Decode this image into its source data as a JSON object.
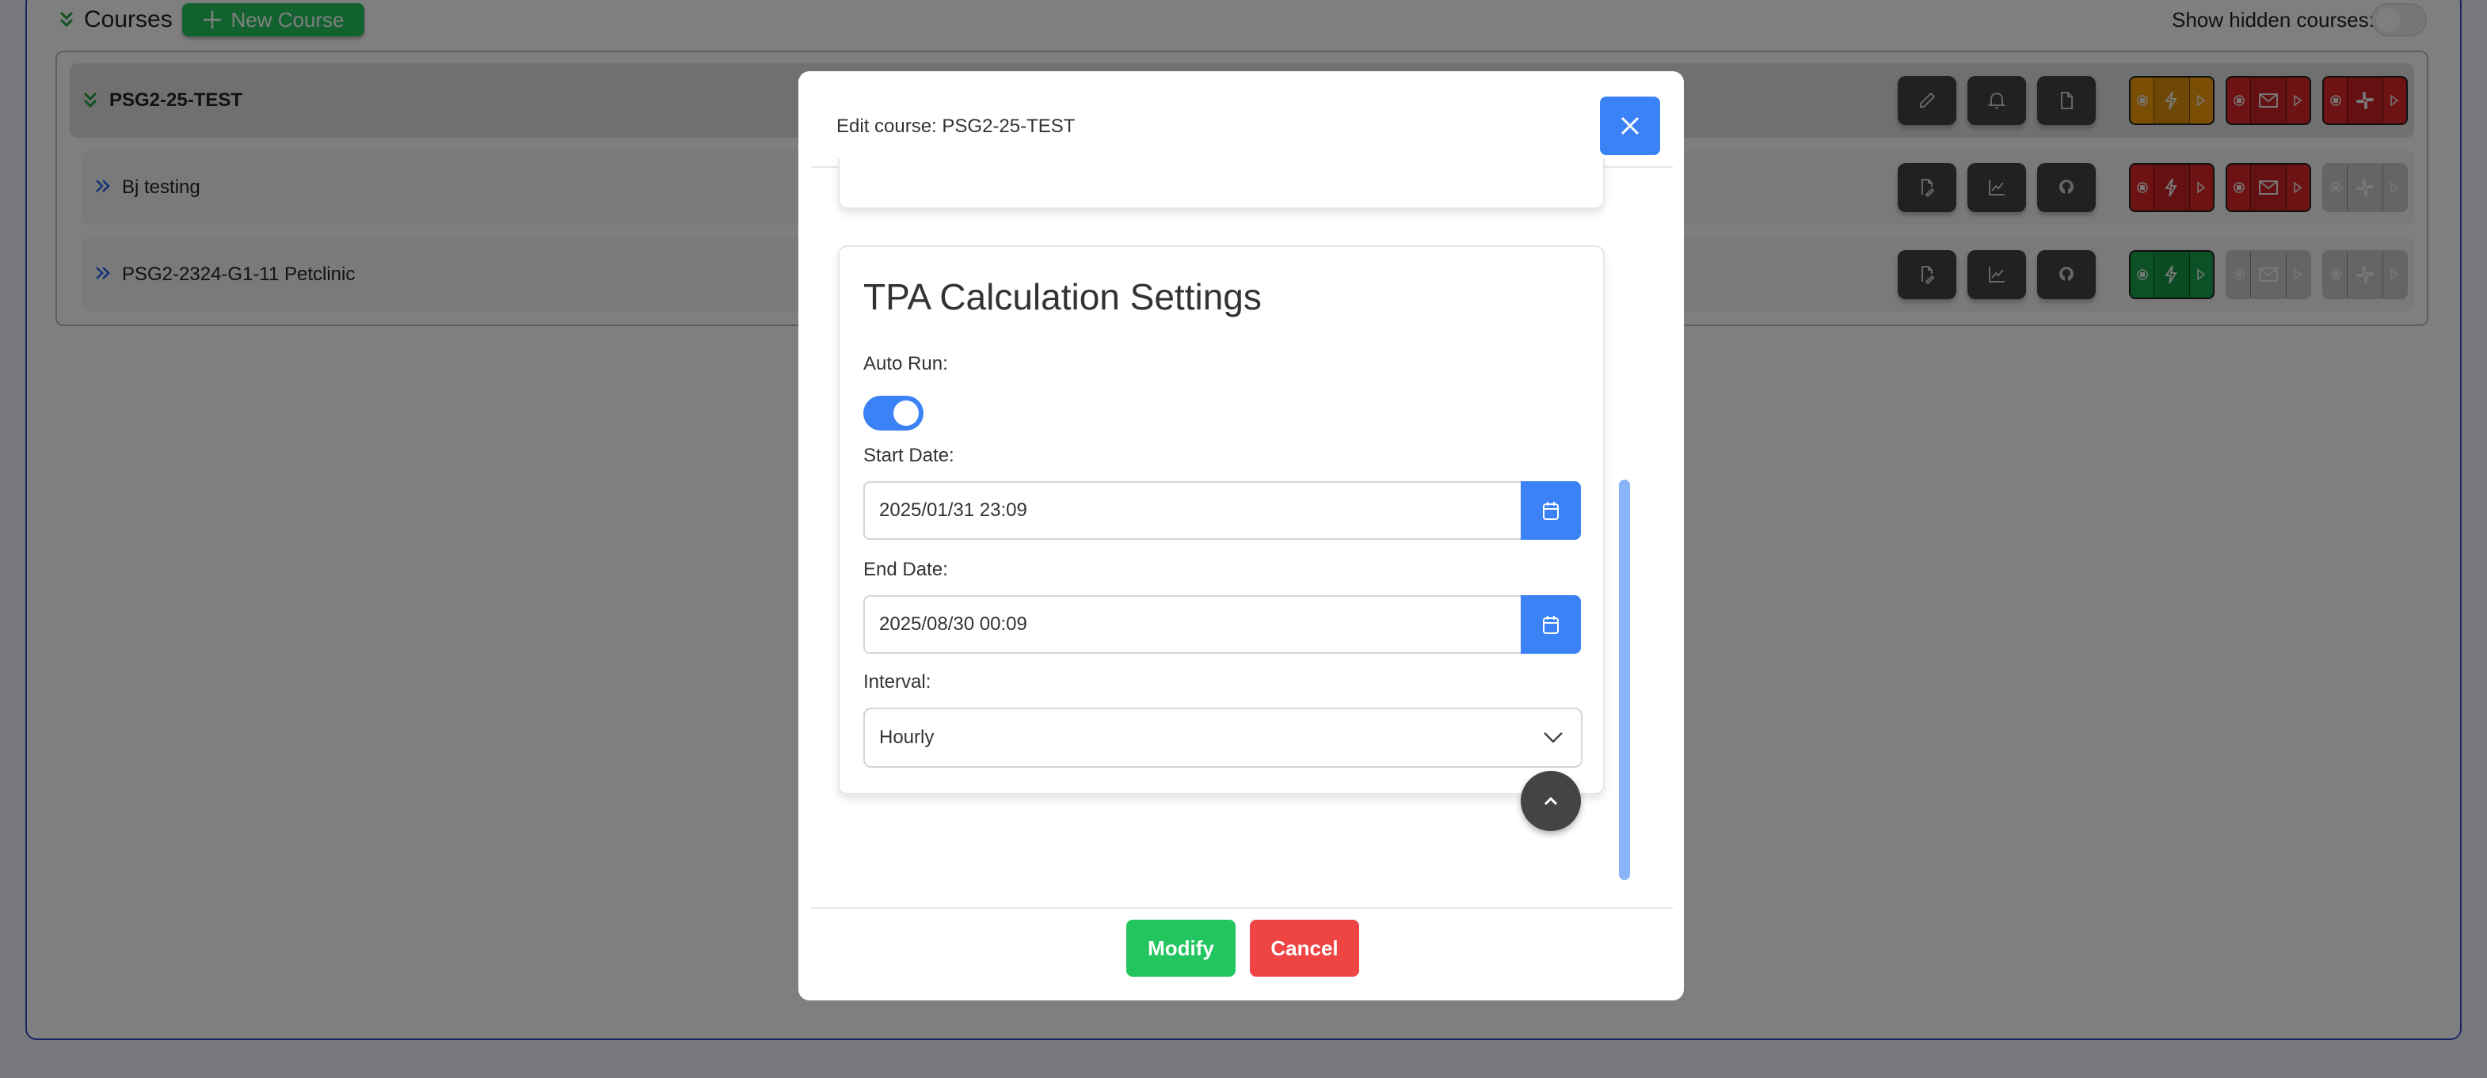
{
  "header": {
    "title": "Courses",
    "new_course": "New Course",
    "show_hidden_label": "Show hidden courses:",
    "show_hidden": false
  },
  "courses": [
    {
      "name": "PSG2-25-TEST",
      "expanded": true,
      "buttons": [
        "pencil-icon",
        "bell-icon",
        "file-icon"
      ],
      "groups": [
        {
          "icon": "bolt-icon",
          "status": "warning"
        },
        {
          "icon": "mail-icon",
          "status": "error"
        },
        {
          "icon": "slack-icon",
          "status": "error"
        }
      ]
    },
    {
      "name": "Bj testing",
      "buttons": [
        "file-edit-icon",
        "chart-icon",
        "github-icon"
      ],
      "groups": [
        {
          "icon": "bolt-icon",
          "status": "error"
        },
        {
          "icon": "mail-icon",
          "status": "error"
        },
        {
          "icon": "slack-icon",
          "status": "disabled"
        }
      ]
    },
    {
      "name": "PSG2-2324-G1-11  Petclinic",
      "buttons": [
        "file-edit-icon",
        "chart-icon",
        "github-icon"
      ],
      "groups": [
        {
          "icon": "bolt-icon",
          "status": "success"
        },
        {
          "icon": "mail-icon",
          "status": "disabled"
        },
        {
          "icon": "slack-icon",
          "status": "disabled"
        }
      ]
    }
  ],
  "colors": {
    "warning": "#f59e0b",
    "error": "#dc2626",
    "success": "#16a34a",
    "disabled": "#bdbdbd",
    "primary": "#3b82f6"
  },
  "modal": {
    "title": "Edit course:  PSG2-25-TEST",
    "section_title": "TPA Calculation Settings",
    "auto_run_label": "Auto Run:",
    "auto_run": true,
    "start_label": "Start Date:",
    "start_value": "2025/01/31 23:09",
    "end_label": "End Date:",
    "end_value": "2025/08/30 00:09",
    "interval_label": "Interval:",
    "interval_value": "Hourly",
    "modify": "Modify",
    "cancel": "Cancel"
  }
}
